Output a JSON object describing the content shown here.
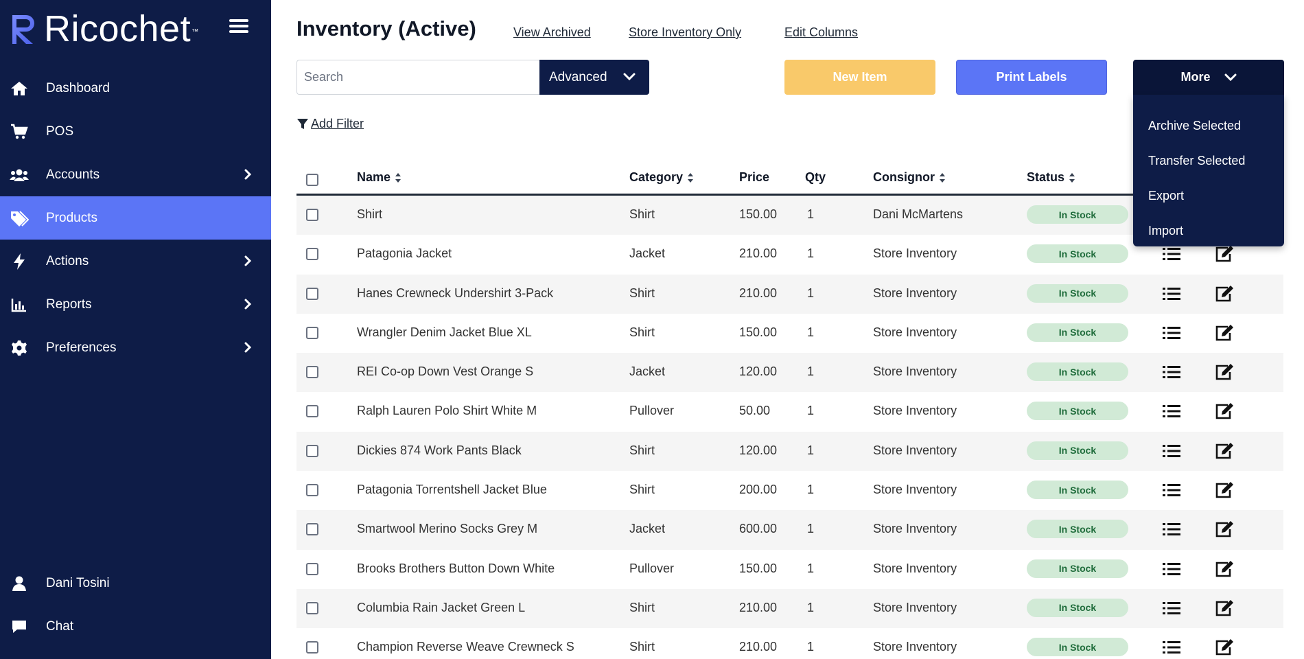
{
  "brand": {
    "name": "Ricochet",
    "tm": "™"
  },
  "sidebar": {
    "items": [
      {
        "label": "Dashboard",
        "icon": "home-icon",
        "has_chevron": false,
        "active": false
      },
      {
        "label": "POS",
        "icon": "cart-icon",
        "has_chevron": false,
        "active": false
      },
      {
        "label": "Accounts",
        "icon": "users-icon",
        "has_chevron": true,
        "active": false
      },
      {
        "label": "Products",
        "icon": "tags-icon",
        "has_chevron": false,
        "active": true
      },
      {
        "label": "Actions",
        "icon": "bolt-icon",
        "has_chevron": true,
        "active": false
      },
      {
        "label": "Reports",
        "icon": "chart-icon",
        "has_chevron": true,
        "active": false
      },
      {
        "label": "Preferences",
        "icon": "gear-icon",
        "has_chevron": true,
        "active": false
      }
    ],
    "bottom": [
      {
        "label": "Dani Tosini",
        "icon": "user-icon"
      },
      {
        "label": "Chat",
        "icon": "chat-icon"
      }
    ]
  },
  "header": {
    "title": "Inventory (Active)",
    "links": [
      "View Archived",
      "Store Inventory Only",
      "Edit Columns"
    ]
  },
  "toolbar": {
    "search_placeholder": "Search",
    "advanced_label": "Advanced",
    "new_item_label": "New Item",
    "print_labels_label": "Print Labels",
    "more_label": "More",
    "more_menu": [
      "Archive Selected",
      "Transfer Selected",
      "Export",
      "Import"
    ],
    "add_filter_label": "Add Filter"
  },
  "colors": {
    "sidebar": "#0e1c47",
    "accent": "#5b75f6",
    "new_item": "#f9c96a",
    "status_bg": "#d1ead6",
    "status_text": "#1f6c3b"
  },
  "table": {
    "columns": [
      "Name",
      "Category",
      "Price",
      "Qty",
      "Consignor",
      "Status"
    ],
    "rows": [
      {
        "name": "Shirt",
        "category": "Shirt",
        "price": "150.00",
        "qty": "1",
        "consignor": "Dani McMartens",
        "status": "In Stock"
      },
      {
        "name": "Patagonia Jacket",
        "category": "Jacket",
        "price": "210.00",
        "qty": "1",
        "consignor": "Store Inventory",
        "status": "In Stock"
      },
      {
        "name": "Hanes Crewneck Undershirt 3-Pack",
        "category": "Shirt",
        "price": "210.00",
        "qty": "1",
        "consignor": "Store Inventory",
        "status": "In Stock"
      },
      {
        "name": "Wrangler Denim Jacket Blue XL",
        "category": "Shirt",
        "price": "150.00",
        "qty": "1",
        "consignor": "Store Inventory",
        "status": "In Stock"
      },
      {
        "name": "REI Co-op Down Vest Orange S",
        "category": "Jacket",
        "price": "120.00",
        "qty": "1",
        "consignor": "Store Inventory",
        "status": "In Stock"
      },
      {
        "name": "Ralph Lauren Polo Shirt White M",
        "category": "Pullover",
        "price": "50.00",
        "qty": "1",
        "consignor": "Store Inventory",
        "status": "In Stock"
      },
      {
        "name": "Dickies 874 Work Pants Black",
        "category": "Shirt",
        "price": "120.00",
        "qty": "1",
        "consignor": "Store Inventory",
        "status": "In Stock"
      },
      {
        "name": "Patagonia Torrentshell Jacket Blue",
        "category": "Shirt",
        "price": "200.00",
        "qty": "1",
        "consignor": "Store Inventory",
        "status": "In Stock"
      },
      {
        "name": "Smartwool Merino Socks Grey M",
        "category": "Jacket",
        "price": "600.00",
        "qty": "1",
        "consignor": "Store Inventory",
        "status": "In Stock"
      },
      {
        "name": "Brooks Brothers Button Down White",
        "category": "Pullover",
        "price": "150.00",
        "qty": "1",
        "consignor": "Store Inventory",
        "status": "In Stock"
      },
      {
        "name": "Columbia Rain Jacket Green L",
        "category": "Shirt",
        "price": "210.00",
        "qty": "1",
        "consignor": "Store Inventory",
        "status": "In Stock"
      },
      {
        "name": "Champion Reverse Weave Crewneck S",
        "category": "Shirt",
        "price": "210.00",
        "qty": "1",
        "consignor": "Store Inventory",
        "status": "In Stock"
      }
    ]
  }
}
